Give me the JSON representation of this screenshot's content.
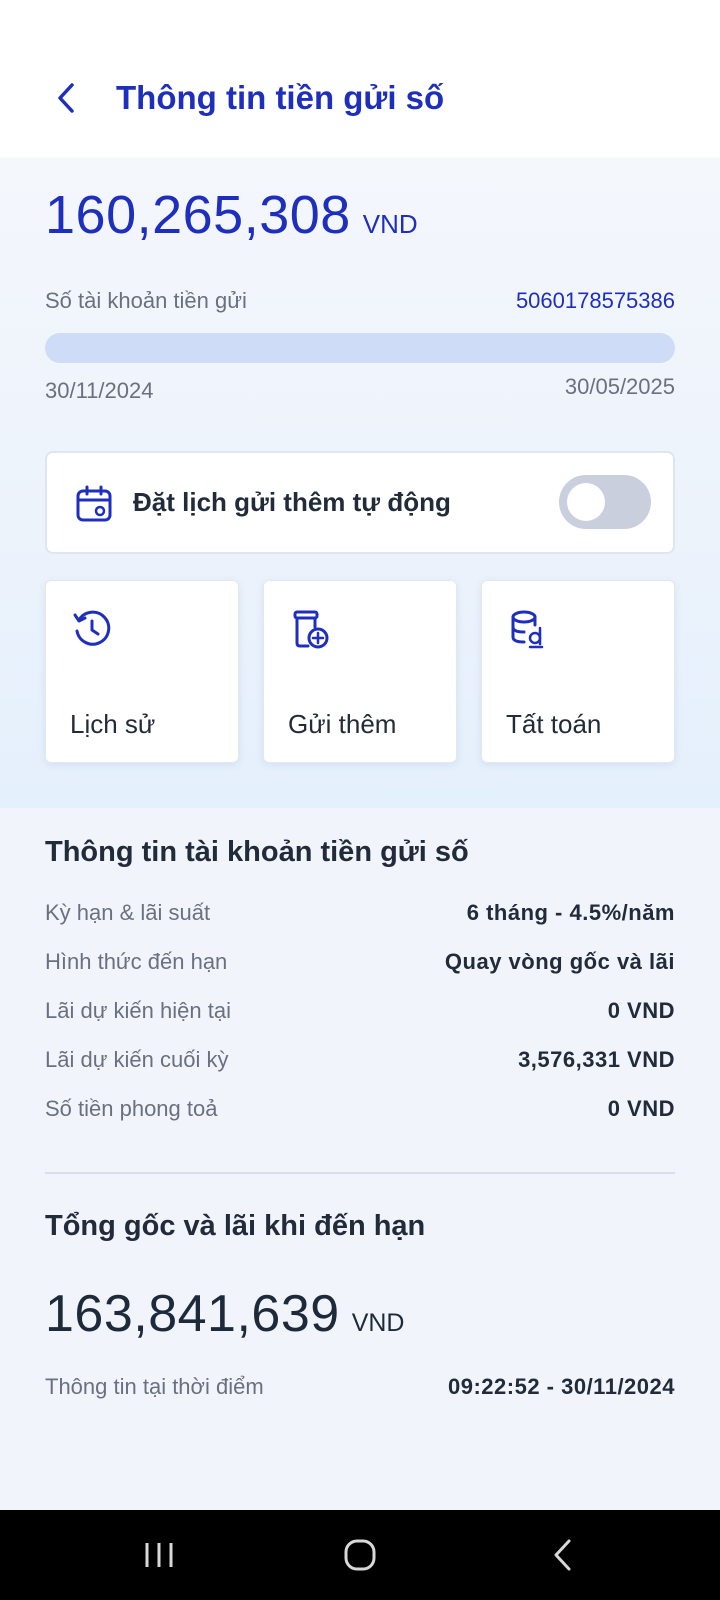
{
  "header": {
    "title": "Thông tin tiền gửi số",
    "back_icon": "chevron-left-icon"
  },
  "deposit": {
    "amount": "160,265,308",
    "currency": "VND",
    "account_label": "Số tài khoản tiền gửi",
    "account_number": "5060178575386",
    "start_date": "30/11/2024",
    "end_date": "30/05/2025",
    "term_progress_fraction": 0
  },
  "auto_schedule": {
    "label": "Đặt lịch gửi thêm tự động",
    "icon": "calendar-icon",
    "enabled": false
  },
  "actions": [
    {
      "label": "Lịch sử",
      "icon": "history-icon"
    },
    {
      "label": "Gửi thêm",
      "icon": "jar-add-icon"
    },
    {
      "label": "Tất toán",
      "icon": "coins-dong-icon"
    }
  ],
  "info": {
    "title": "Thông tin tài khoản tiền gửi số",
    "rows": [
      {
        "label": "Kỳ hạn & lãi suất",
        "value": "6 tháng - 4.5%/năm"
      },
      {
        "label": "Hình thức đến hạn",
        "value": "Quay vòng gốc và lãi"
      },
      {
        "label": "Lãi dự kiến hiện tại",
        "value": "0 VND"
      },
      {
        "label": "Lãi dự kiến cuối kỳ",
        "value": "3,576,331 VND"
      },
      {
        "label": "Số tiền phong toả",
        "value": "0 VND"
      }
    ]
  },
  "maturity": {
    "title": "Tổng gốc và lãi khi đến hạn",
    "amount": "163,841,639",
    "currency": "VND",
    "timestamp_label": "Thông tin tại thời điểm",
    "timestamp_value": "09:22:52 - 30/11/2024"
  },
  "colors": {
    "brand_blue": "#1f2fbd",
    "progress_track": "#cfdcf8",
    "text_primary": "#222b3a",
    "text_secondary": "#6b7080"
  },
  "navbar": {
    "buttons": [
      "recent-apps-icon",
      "home-icon",
      "back-icon"
    ]
  }
}
